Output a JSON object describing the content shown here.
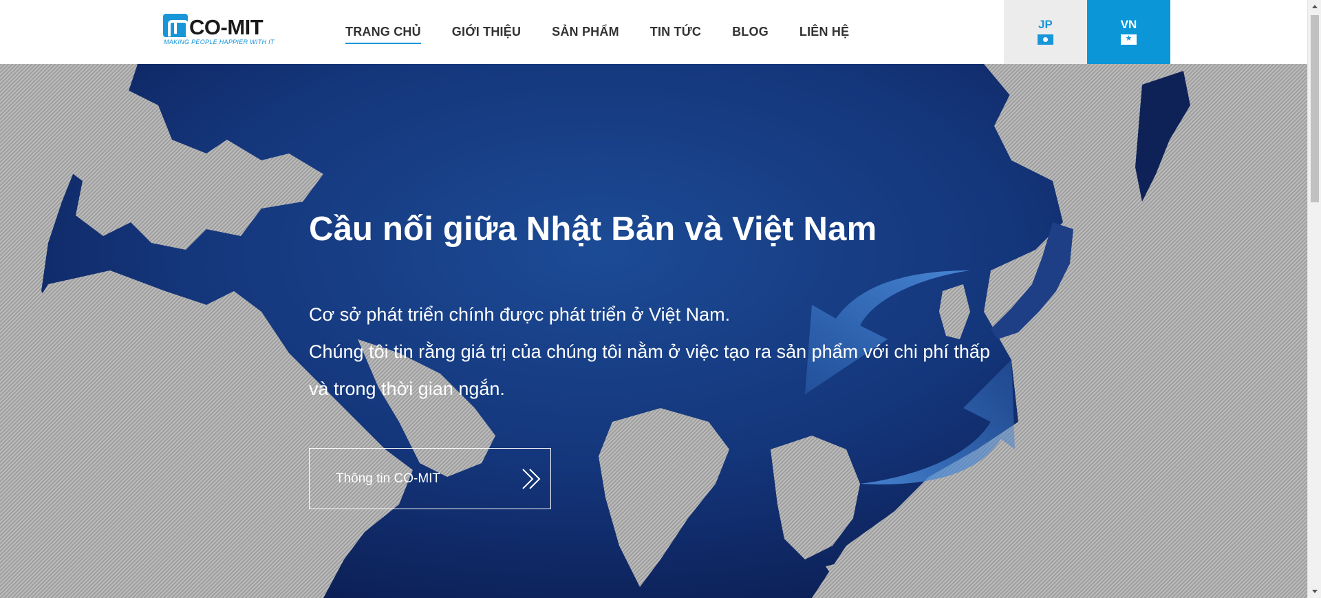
{
  "header": {
    "logo_text": "CO-MIT",
    "logo_tagline": "MAKING PEOPLE HAPPIER WITH IT",
    "nav": [
      {
        "label": "TRANG CHỦ"
      },
      {
        "label": "GIỚI THIỆU"
      },
      {
        "label": "SẢN PHẨM"
      },
      {
        "label": "TIN TỨC"
      },
      {
        "label": "BLOG"
      },
      {
        "label": "LIÊN HỆ"
      }
    ],
    "lang_jp": "JP",
    "lang_vn": "VN"
  },
  "hero": {
    "title": "Cầu nối giữa Nhật Bản và Việt Nam",
    "line1": "Cơ sở phát triển chính được phát triển ở Việt Nam.",
    "line2": "Chúng tôi tin rằng giá trị của chúng tôi nằm ở việc tạo ra sản phẩm với chi phí thấp và trong thời gian ngắn.",
    "button_label": "Thông tin CO-MIT"
  },
  "icons": {
    "logo": "comit-logo-icon",
    "jp_flag": "japan-flag-icon",
    "vn_flag": "vietnam-flag-icon",
    "button_arrow": "double-chevron-right-icon"
  },
  "colors": {
    "brand_blue": "#1996d8",
    "ocean_dark": "#0c1d52",
    "ocean_mid": "#15408a",
    "land": "#b9b9b9",
    "arrow_blue": "#3f7fd0"
  }
}
